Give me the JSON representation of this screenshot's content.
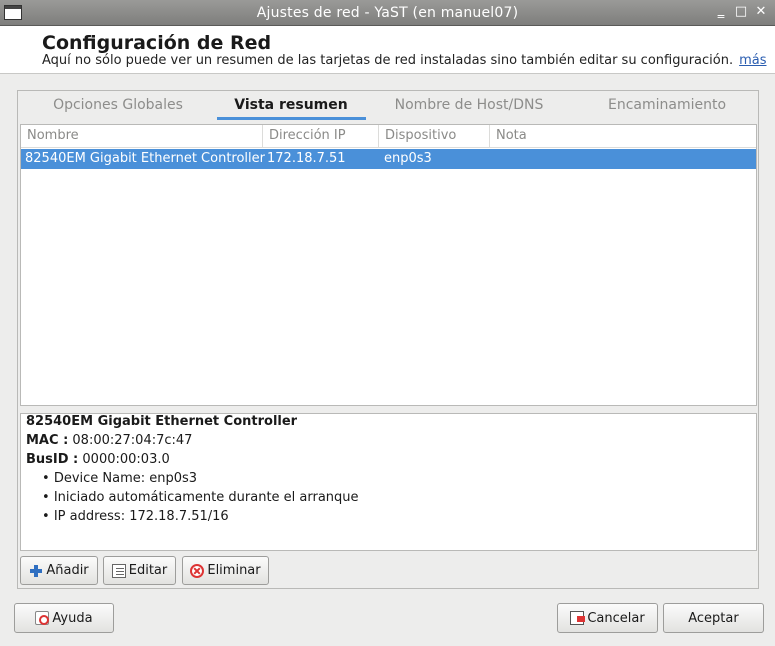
{
  "window": {
    "title": "Ajustes de red - YaST (en manuel07)",
    "controls": {
      "minimize": "‗",
      "maximize": "□",
      "close": "✕"
    }
  },
  "header": {
    "title": "Configuración de Red",
    "subtitle": "Aquí no sólo puede ver un resumen de las tarjetas de red instaladas sino también editar su configuración.",
    "more_link": "más"
  },
  "tabs": [
    {
      "label": "Opciones Globales",
      "active": false
    },
    {
      "label": "Vista resumen",
      "active": true
    },
    {
      "label": "Nombre de Host/DNS",
      "active": false
    },
    {
      "label": "Encaminamiento",
      "active": false
    }
  ],
  "table": {
    "columns": [
      "Nombre",
      "Dirección IP",
      "Dispositivo",
      "Nota"
    ],
    "rows": [
      {
        "nombre": "82540EM Gigabit Ethernet Controller",
        "ip": "172.18.7.51",
        "dispositivo": "enp0s3",
        "nota": "",
        "selected": true
      }
    ]
  },
  "details": {
    "title": "82540EM Gigabit Ethernet Controller",
    "mac_label": "MAC :",
    "mac_value": "08:00:27:04:7c:47",
    "busid_label": "BusID :",
    "busid_value": "0000:00:03.0",
    "items": [
      "Device Name: enp0s3",
      "Iniciado automáticamente durante el arranque",
      "IP address: 172.18.7.51/16"
    ]
  },
  "actions": {
    "add": "Añadir",
    "edit": "Editar",
    "delete": "Eliminar"
  },
  "footer": {
    "help": "Ayuda",
    "cancel": "Cancelar",
    "accept": "Aceptar"
  },
  "colors": {
    "selection": "#4a90d9",
    "link": "#2a5db0",
    "titlebar": "#8c8c8a"
  },
  "icons": {
    "add": "plus-icon",
    "edit": "edit-icon",
    "delete": "delete-icon",
    "help": "help-icon",
    "cancel": "cancel-icon"
  }
}
